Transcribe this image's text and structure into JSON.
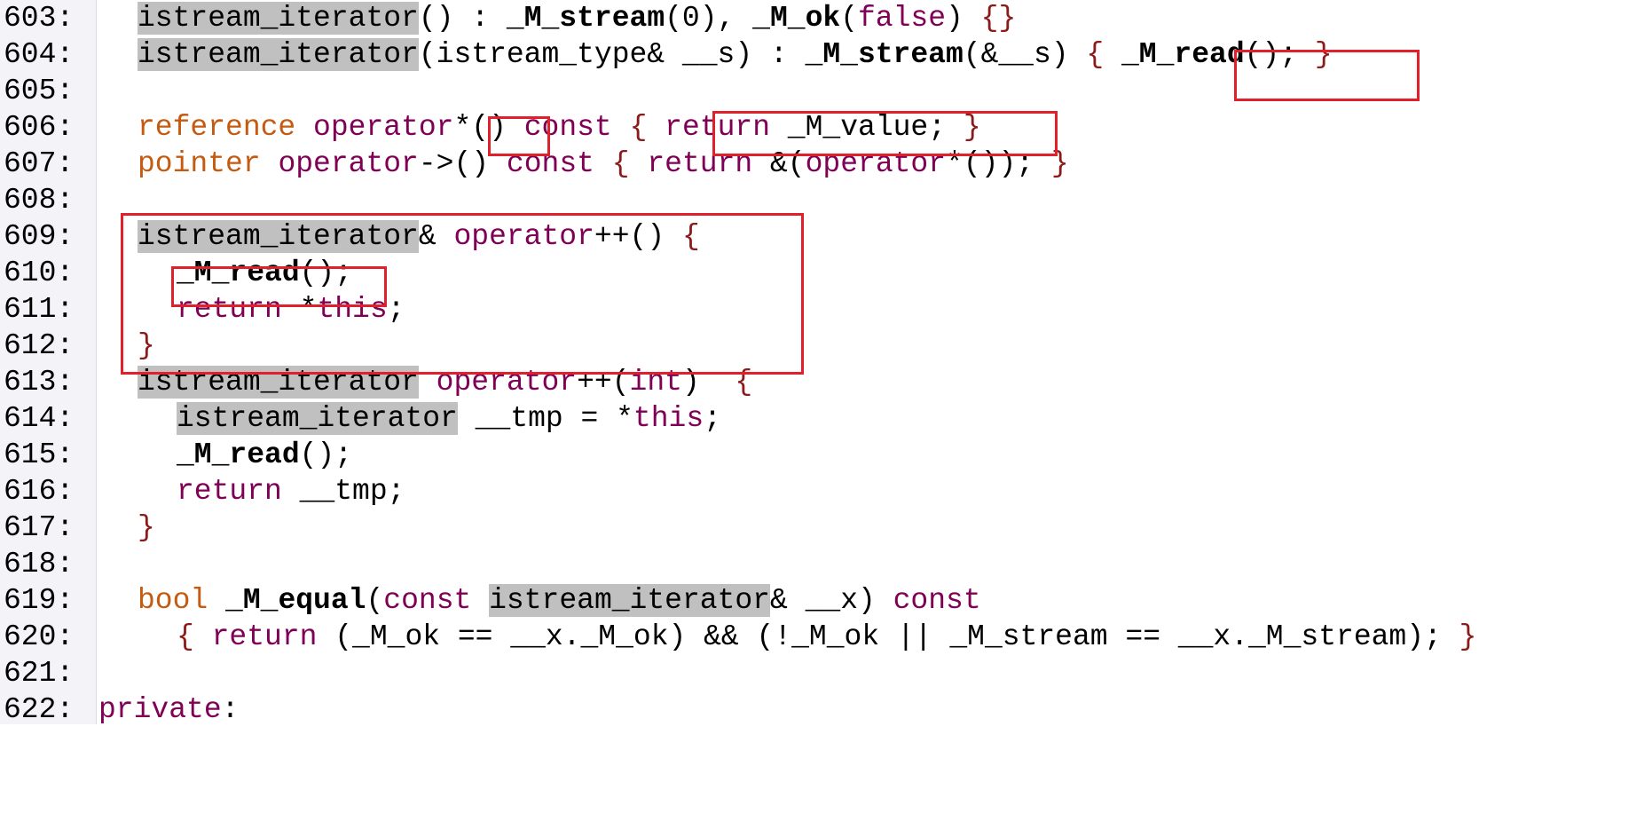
{
  "gutter": {
    "line_numbers": [
      "603:",
      "604:",
      "605:",
      "606:",
      "607:",
      "608:",
      "609:",
      "610:",
      "611:",
      "612:",
      "613:",
      "614:",
      "615:",
      "616:",
      "617:",
      "618:",
      "619:",
      "620:",
      "621:",
      "622:"
    ]
  },
  "code": {
    "l603": {
      "a": "istream_iterator",
      "b": "() : ",
      "c": "_M_stream",
      "d": "(0), ",
      "e": "_M_ok",
      "f": "(",
      "g": "false",
      "h": ") ",
      "i": "{}"
    },
    "l604": {
      "a": "istream_iterator",
      "b": "(istream_type& __s) : ",
      "c": "_M_stream",
      "d": "(&__s) ",
      "e": "{ ",
      "f": "_M_read",
      "g": "(); ",
      "h": "}"
    },
    "l606": {
      "a": "reference",
      "b": " ",
      "c": "operator",
      "d": "*()",
      "e": " ",
      "f": "const",
      "g": " ",
      "h": "{ ",
      "i": "return",
      "j": " _M_value; ",
      "k": "}"
    },
    "l607": {
      "a": "pointer",
      "b": " ",
      "c": "operator",
      "d": "->() ",
      "e": "const",
      "f": " ",
      "g": "{ ",
      "h": "return",
      "i": " &(",
      "j": "operator",
      "k": "*()); ",
      "l": "}"
    },
    "l609": {
      "a": "istream_iterator",
      "b": "& ",
      "c": "operator",
      "d": "++() ",
      "e": "{"
    },
    "l610": {
      "a": "_M_read",
      "b": "();"
    },
    "l611": {
      "a": "return",
      "b": " *",
      "c": "this",
      "d": ";"
    },
    "l612": {
      "a": "}"
    },
    "l613": {
      "a": "istream_iterator",
      "b": " ",
      "c": "operator",
      "d": "++(",
      "e": "int",
      "f": ")  ",
      "g": "{"
    },
    "l614": {
      "a": "istream_iterator",
      "b": " __tmp = *",
      "c": "this",
      "d": ";"
    },
    "l615": {
      "a": "_M_read",
      "b": "();"
    },
    "l616": {
      "a": "return",
      "b": " __tmp;"
    },
    "l617": {
      "a": "}"
    },
    "l619": {
      "a": "bool",
      "b": " ",
      "c": "_M_equal",
      "d": "(",
      "e": "const",
      "f": " ",
      "g": "istream_iterator",
      "h": "& __x) ",
      "i": "const"
    },
    "l620": {
      "a": "{ ",
      "b": "return",
      "c": " (_M_ok == __x._M_ok) && (!_M_ok || _M_stream == __x._M_stream); ",
      "d": "}"
    },
    "l622": {
      "a": "private",
      "b": ":"
    }
  },
  "colors": {
    "keyword": "#7f0055",
    "type": "#c55a11",
    "highlight": "#c0c0c0",
    "annotation_box": "#e0202a"
  }
}
